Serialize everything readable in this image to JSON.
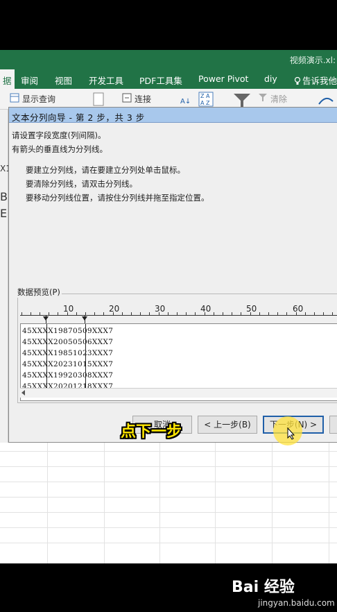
{
  "window": {
    "file_name": "视频演示.xl:"
  },
  "ribbon": {
    "active_tab_fragment": "据",
    "tabs": [
      "审阅",
      "视图",
      "开发工具",
      "PDF工具集",
      "Power Pivot",
      "diy"
    ],
    "tell_me": "告诉我他",
    "items": {
      "show_query": "显示查询",
      "connections": "连接",
      "clear": "清除",
      "sort_az": "Z A",
      "sort_za": "A Z"
    }
  },
  "left_cells": {
    "cell_ref": "X1",
    "letter_b": "B",
    "letter_e": "E"
  },
  "dialog": {
    "title": "文本分列向导 - 第 2 步，共 3 步",
    "instructions": {
      "line1": "请设置字段宽度(列间隔)。",
      "line2": "有箭头的垂直线为分列线。",
      "bullet1": "要建立分列线，请在要建立分列处单击鼠标。",
      "bullet2": "要清除分列线，请双击分列线。",
      "bullet3": "要移动分列线位置，请按住分列线并拖至指定位置。"
    },
    "preview_label": "数据预览(P)",
    "ruler_numbers": [
      "10",
      "20",
      "30",
      "40",
      "50",
      "60"
    ],
    "preview_rows": [
      "45XXXX19870509XXX7",
      "45XXXX20050506XXX7",
      "45XXXX19851023XXX7",
      "45XXXX20231015XXX7",
      "45XXXX19920308XXX7",
      "45XXXX20201218XXX7"
    ],
    "buttons": {
      "cancel": "取消",
      "back": "< 上一步(B)",
      "next": "下一步(N) >"
    }
  },
  "overlay": {
    "caption": "点下一步"
  },
  "watermark": {
    "logo": "Bai 经验",
    "url": "jingyan.baidu.com"
  },
  "colors": {
    "excel_green": "#217346",
    "dialog_title_bg": "#a8c8ec",
    "caption": "#ffe600",
    "highlight": "#ffe23c"
  }
}
